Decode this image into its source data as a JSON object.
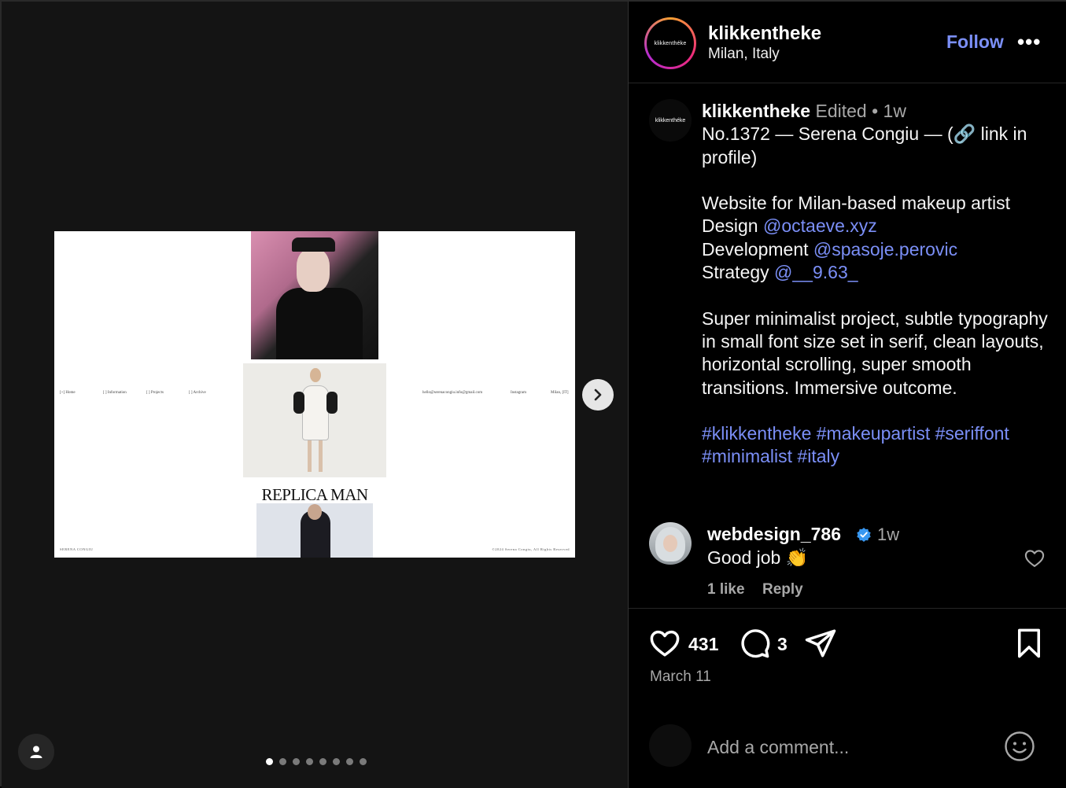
{
  "header": {
    "avatar_text": "klikkenthéke",
    "username": "klikkentheke",
    "location": "Milan, Italy",
    "follow_label": "Follow",
    "more_label": "•••"
  },
  "slide": {
    "nav": [
      "[+] Home",
      "[ ] Information",
      "[ ] Projects",
      "[ ] Archive"
    ],
    "contact": "hello@serenacongiu.info@gmail.com",
    "instagram": "Instagram",
    "city": "Milan, [IT]",
    "brand": "SERENA CONGIU",
    "copyright": "©2024 Serena Congiu, All Rights Reserved",
    "magazine_title": "REPLICA MAN"
  },
  "carousel": {
    "dot_count": 8,
    "active_index": 0
  },
  "caption": {
    "avatar_text": "klikkenthéke",
    "username": "klikkentheke",
    "edited": "Edited",
    "separator": "•",
    "time": "1w",
    "line1": "No.1372 — Serena Congiu — (🔗 link in profile)",
    "line2": "Website for Milan-based makeup artist",
    "design_label": "Design",
    "design_handle": "@octaeve.xyz",
    "dev_label": "Development",
    "dev_handle": "@spasoje.perovic",
    "strategy_label": "Strategy",
    "strategy_handle": "@__9.63_",
    "description": "Super minimalist project, subtle typography in small font size set in serif, clean layouts, horizontal scrolling, super smooth transitions. Immersive outcome.",
    "hashtags": "#klikkentheke #makeupartist #seriffont #minimalist #italy"
  },
  "comment": {
    "username": "webdesign_786",
    "time": "1w",
    "text": "Good job 👏",
    "likes": "1 like",
    "reply": "Reply"
  },
  "actions": {
    "like_count": "431",
    "comment_count": "3",
    "date": "March 11"
  },
  "add_comment": {
    "placeholder": "Add a comment..."
  },
  "colors": {
    "link": "#7b8ff7",
    "muted": "#a8a8a8",
    "verified": "#3897f0"
  }
}
